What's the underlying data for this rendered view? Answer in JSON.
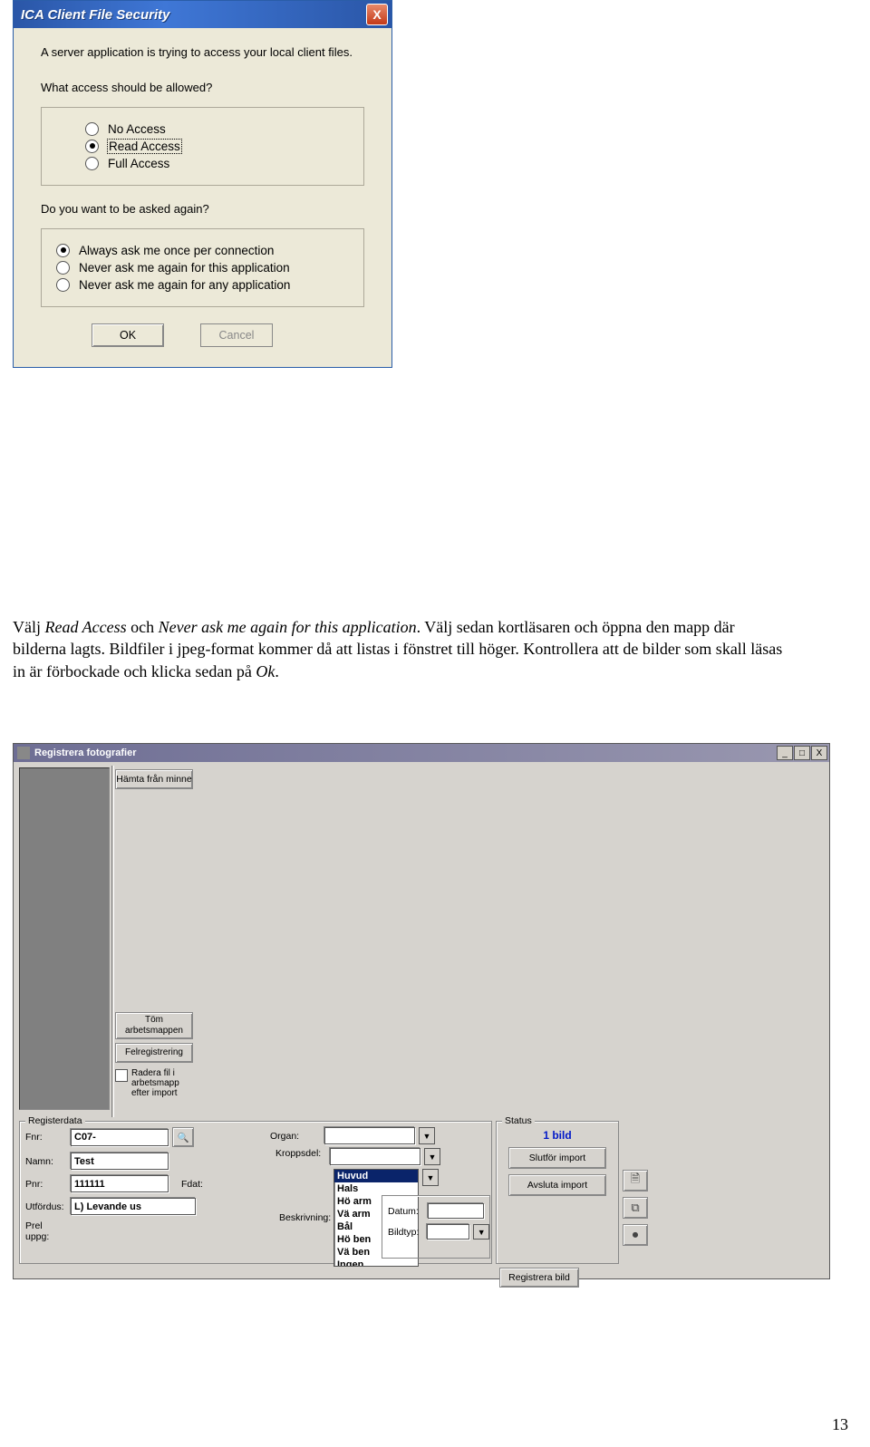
{
  "ica": {
    "title": "ICA Client File Security",
    "close_symbol": "X",
    "msg": "A server application is trying to access your local client files.",
    "q1": "What access should be allowed?",
    "options1": [
      {
        "label": "No Access",
        "selected": false
      },
      {
        "label": "Read Access",
        "selected": true
      },
      {
        "label": "Full Access",
        "selected": false
      }
    ],
    "q2": "Do you want to be asked again?",
    "options2": [
      {
        "label": "Always ask me once per connection",
        "selected": true
      },
      {
        "label": "Never ask me again for this application",
        "selected": false
      },
      {
        "label": "Never ask me again for any application",
        "selected": false
      }
    ],
    "ok_label": "OK",
    "cancel_label": "Cancel"
  },
  "doc": {
    "p1a": "Välj ",
    "p1b": "Read Access",
    "p1c": " och ",
    "p1d": "Never ask me again for this application",
    "p1e": ". Välj sedan kortläsaren och öppna den mapp där bilderna lagts. Bildfiler i jpeg-format kommer då att listas i fönstret till höger. Kontrollera att de bilder som skall läsas in är förbockade och klicka sedan på ",
    "p1f": "Ok",
    "p1g": "."
  },
  "reg": {
    "title": "Registrera fotografier",
    "btn_hamta": "Hämta från minne",
    "btn_tom": "Töm arbetsmappen",
    "btn_felreg": "Felregistrering",
    "chk_radera": "Radera fil i arbetsmapp efter import",
    "legend_reg": "Registerdata",
    "labels": {
      "fnr": "Fnr:",
      "namn": "Namn:",
      "pnr": "Pnr:",
      "fdat": "Fdat:",
      "utf": "Utfördus:",
      "prel": "Prel uppg:",
      "organ": "Organ:",
      "kropp": "Kroppsdel:",
      "beskr": "Beskrivning:",
      "datum": "Datum:",
      "bildtyp": "Bildtyp:"
    },
    "values": {
      "fnr": "C07-",
      "namn": "Test",
      "pnr": "111111",
      "utf": "L) Levande us"
    },
    "kroppsdel_list": [
      "Huvud",
      "Hals",
      "Hö arm",
      "Vä arm",
      "Bål",
      "Hö ben",
      "Vä ben",
      "Ingen"
    ],
    "kroppsdel_selected": "Huvud",
    "legend_status": "Status",
    "status_count": "1 bild",
    "btn_slutfor": "Slutför import",
    "btn_avsluta": "Avsluta import",
    "btn_regbild": "Registrera bild",
    "winctrls": {
      "min": "_",
      "max": "□",
      "close": "X"
    }
  },
  "page_number": "13"
}
